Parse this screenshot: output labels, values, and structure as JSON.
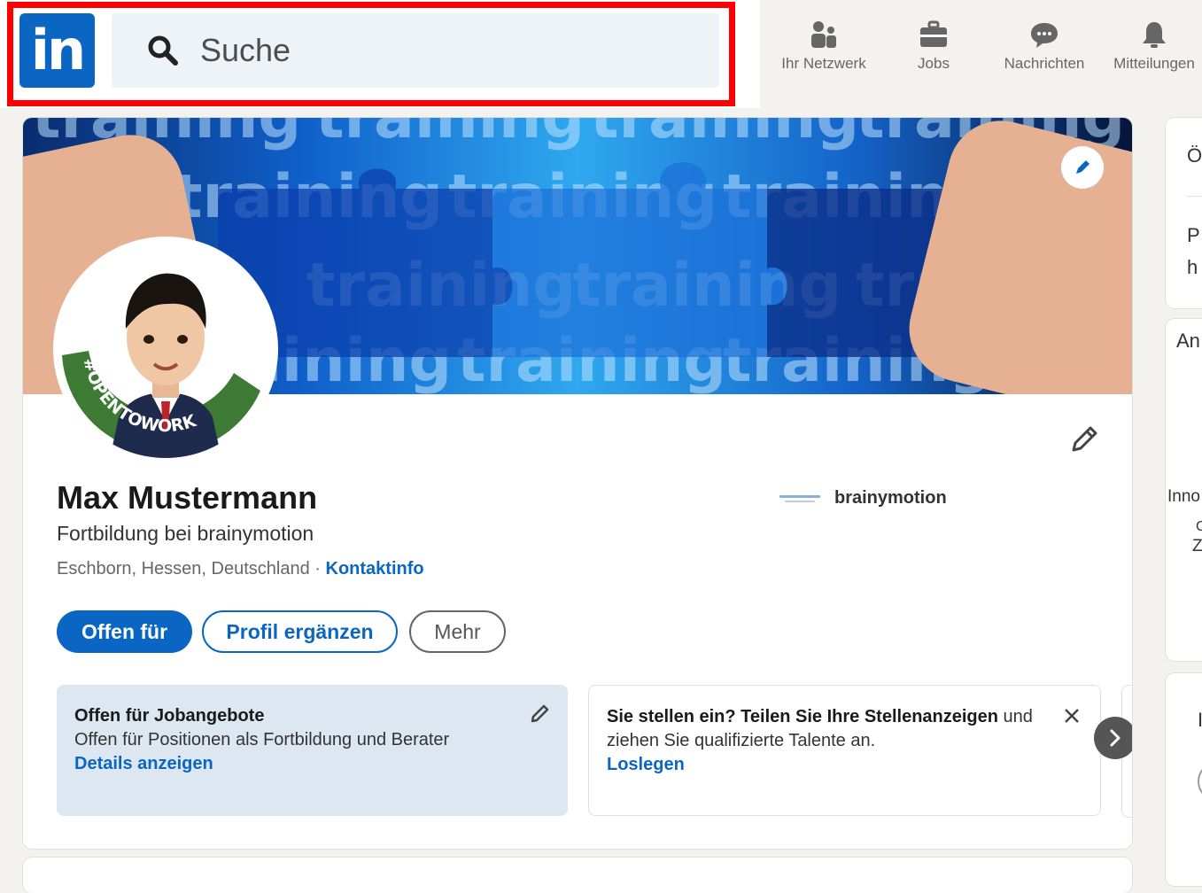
{
  "header": {
    "logo_text": "in",
    "search_placeholder": "Suche",
    "nav": [
      {
        "label": "Ihr Netzwerk",
        "icon": "network-icon"
      },
      {
        "label": "Jobs",
        "icon": "briefcase-icon"
      },
      {
        "label": "Nachrichten",
        "icon": "message-icon"
      },
      {
        "label": "Mitteilungen",
        "icon": "bell-icon"
      }
    ]
  },
  "banner": {
    "text": "training"
  },
  "avatar": {
    "badge_text": "#OPENTOWORK"
  },
  "profile": {
    "name": "Max Mustermann",
    "headline": "Fortbildung bei brainymotion",
    "location": "Eschborn, Hessen, Deutschland",
    "separator": " · ",
    "contact_link": "Kontaktinfo",
    "company": "brainymotion"
  },
  "actions": {
    "primary": "Offen für",
    "secondary": "Profil ergänzen",
    "more": "Mehr"
  },
  "open_to_work_box": {
    "title": "Offen für Jobangebote",
    "text": "Offen für Positionen als Fortbildung und Berater",
    "link": "Details anzeigen"
  },
  "hiring_box": {
    "title": "Sie stellen ein? Teilen Sie Ihre Stellenanzeigen",
    "text_after_title": " und",
    "text": "ziehen Sie qualifizierte Talente an.",
    "link": "Loslegen"
  },
  "sidebar_peek": {
    "a": "Ö",
    "b": "P",
    "c": "h",
    "d": "An",
    "e": "Inno",
    "f": "C",
    "g": "Z",
    "h": "I"
  },
  "colors": {
    "brand": "#0a66c2",
    "highlight": "#ff0000"
  }
}
